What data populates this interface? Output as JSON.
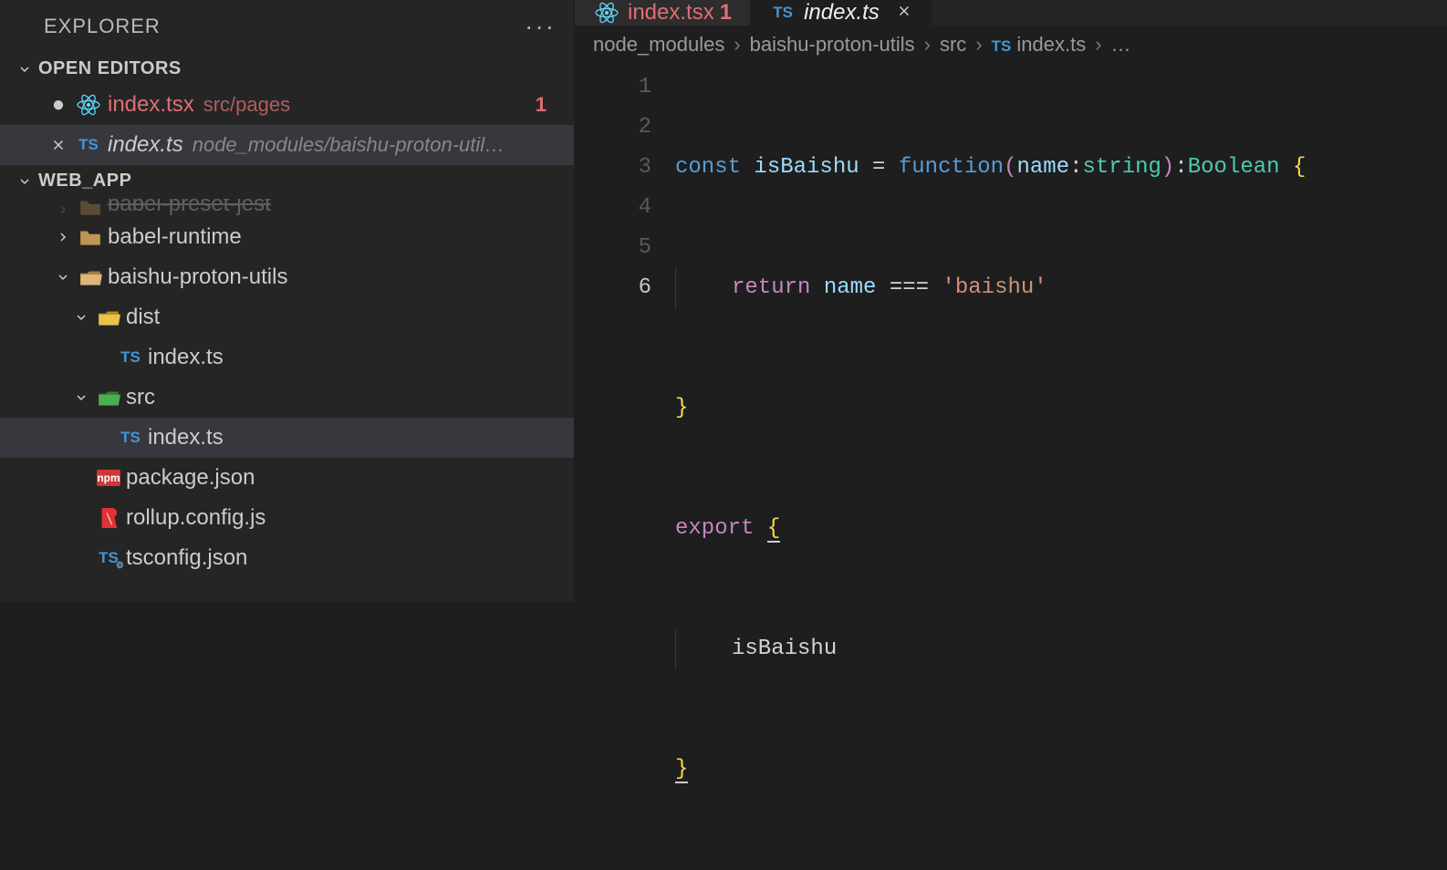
{
  "explorer": {
    "title": "EXPLORER"
  },
  "sections": {
    "openEditors": {
      "label": "OPEN EDITORS",
      "items": [
        {
          "name": "index.tsx",
          "path": "src/pages",
          "badge": "1",
          "icon": "react",
          "modified": true,
          "active": false
        },
        {
          "name": "index.ts",
          "path": "node_modules/baishu-proton-util…",
          "icon": "ts",
          "modified": false,
          "active": true,
          "italic": true
        }
      ]
    },
    "project": {
      "label": "WEB_APP"
    }
  },
  "tree": [
    {
      "depth": 0,
      "type": "folder-cut",
      "label": "babel-preset-jest",
      "expanded": false,
      "cut": true
    },
    {
      "depth": 0,
      "type": "folder",
      "label": "babel-runtime",
      "expanded": false
    },
    {
      "depth": 0,
      "type": "folder-open",
      "label": "baishu-proton-utils",
      "expanded": true
    },
    {
      "depth": 1,
      "type": "folder-open-dist",
      "label": "dist",
      "expanded": true
    },
    {
      "depth": 2,
      "type": "file-ts",
      "label": "index.ts"
    },
    {
      "depth": 1,
      "type": "folder-open-src",
      "label": "src",
      "expanded": true
    },
    {
      "depth": 2,
      "type": "file-ts",
      "label": "index.ts",
      "selected": true
    },
    {
      "depth": 1,
      "type": "file-npm",
      "label": "package.json"
    },
    {
      "depth": 1,
      "type": "file-rollup",
      "label": "rollup.config.js"
    },
    {
      "depth": 1,
      "type": "file-tsconfig",
      "label": "tsconfig.json"
    }
  ],
  "tabs": [
    {
      "name": "index.tsx",
      "icon": "react",
      "badge": "1",
      "modified": true,
      "active": false
    },
    {
      "name": "index.ts",
      "icon": "ts",
      "active": true,
      "italic": true,
      "closable": true
    }
  ],
  "breadcrumb": {
    "segments": [
      "node_modules",
      "baishu-proton-utils",
      "src"
    ],
    "file": "index.ts",
    "trailing": "…"
  },
  "code": {
    "lineCount": 6,
    "activeLine": 6,
    "tokens": {
      "l1": {
        "const": "const",
        "name": "isBaishu",
        "eq": " = ",
        "function": "function",
        "lp": "(",
        "param": "name",
        "colon1": ":",
        "ptype": "string",
        "rp": ")",
        "colon2": ":",
        "rtype": "Boolean",
        "sp": " ",
        "lb": "{"
      },
      "l2": {
        "return": "return",
        "var": "name",
        "op": " === ",
        "str": "'baishu'"
      },
      "l3": {
        "rb": "}"
      },
      "l4": {
        "export": "export",
        "sp": " ",
        "lb": "{"
      },
      "l5": {
        "ident": "isBaishu"
      },
      "l6": {
        "rb": "}"
      }
    }
  }
}
